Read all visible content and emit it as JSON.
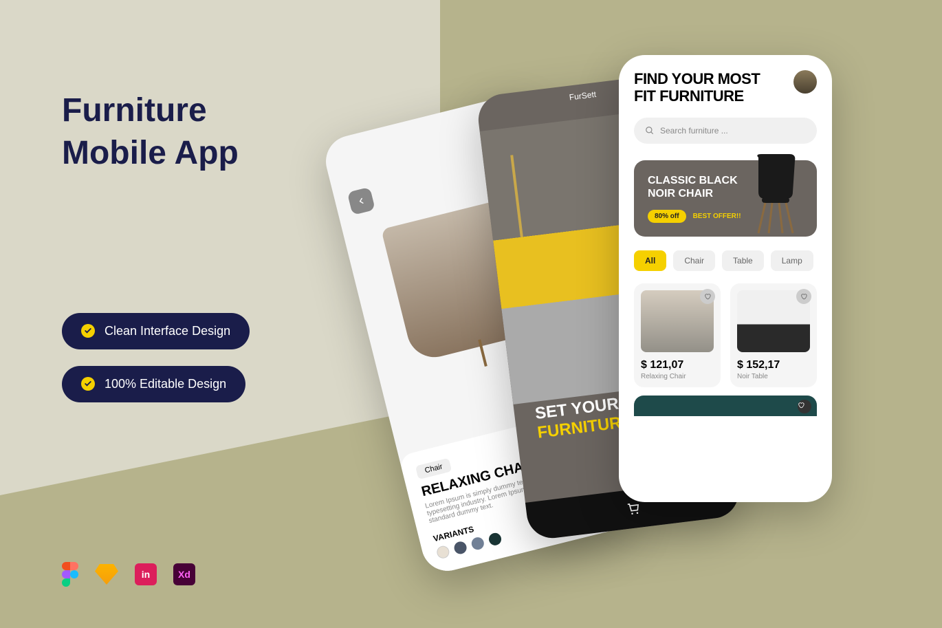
{
  "title_line1": "Furniture",
  "title_line2": "Mobile App",
  "features": {
    "item1": "Clean Interface Design",
    "item2": "100% Editable Design"
  },
  "tools": [
    "figma",
    "sketch",
    "invision",
    "xd"
  ],
  "phone1": {
    "category_chip": "Chair",
    "product_title": "RELAXING CHAIR",
    "description": "Lorem Ipsum is simply dummy text of the printing and typesetting industry. Lorem Ipsum has been the industry's standard dummy text.",
    "variants_label": "VARIANTS",
    "colors": [
      "#e8e0d4",
      "#4a5568",
      "#718096",
      "#1a3535"
    ]
  },
  "phone2": {
    "brand": "FurSett",
    "hero_line1": "SET YOUR",
    "hero_line2": "FURNITURE"
  },
  "phone3": {
    "headline_line1": "FIND YOUR MOST",
    "headline_line2": "FIT FURNITURE",
    "search_placeholder": "Search furniture ...",
    "promo": {
      "title_line1": "CLASSIC BLACK",
      "title_line2": "NOIR CHAIR",
      "discount": "80% off",
      "offer_text": "BEST OFFER!!"
    },
    "categories": {
      "c1": "All",
      "c2": "Chair",
      "c3": "Table",
      "c4": "Lamp"
    },
    "products": {
      "p1": {
        "price": "$ 121,07",
        "name": "Relaxing Chair"
      },
      "p2": {
        "price": "$ 152,17",
        "name": "Noir Table"
      }
    }
  }
}
